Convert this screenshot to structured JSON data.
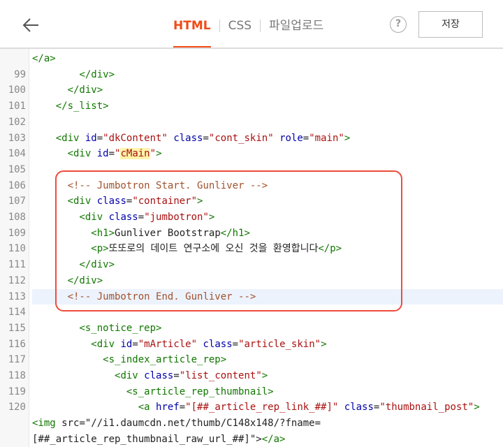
{
  "toolbar": {
    "tabs": [
      {
        "label": "HTML",
        "active": true
      },
      {
        "label": "CSS",
        "active": false
      },
      {
        "label": "파일업로드",
        "active": false
      }
    ],
    "help_label": "?",
    "save_label": "저장"
  },
  "editor": {
    "highlight_line": "113",
    "lines": [
      {
        "num": "",
        "text": "</a>"
      },
      {
        "num": "99",
        "text": "        </div>"
      },
      {
        "num": "100",
        "text": "      </div>"
      },
      {
        "num": "101",
        "text": "    </s_list>"
      },
      {
        "num": "102",
        "text": ""
      },
      {
        "num": "103",
        "text": "    <div id=\"dkContent\" class=\"cont_skin\" role=\"main\">"
      },
      {
        "num": "104",
        "text": "      <div id=\"cMain\">"
      },
      {
        "num": "105",
        "text": ""
      },
      {
        "num": "106",
        "text": "      <!-- Jumbotron Start. Gunliver -->"
      },
      {
        "num": "107",
        "text": "      <div class=\"container\">"
      },
      {
        "num": "108",
        "text": "        <div class=\"jumbotron\">"
      },
      {
        "num": "109",
        "text": "          <h1>Gunliver Bootstrap</h1>"
      },
      {
        "num": "110",
        "text": "          <p>또또로의 데이트 연구소에 오신 것을 환영합니다</p>"
      },
      {
        "num": "111",
        "text": "        </div>"
      },
      {
        "num": "112",
        "text": "      </div>"
      },
      {
        "num": "113",
        "text": "      <!-- Jumbotron End. Gunliver -->"
      },
      {
        "num": "114",
        "text": ""
      },
      {
        "num": "115",
        "text": "        <s_notice_rep>"
      },
      {
        "num": "116",
        "text": "          <div id=\"mArticle\" class=\"article_skin\">"
      },
      {
        "num": "117",
        "text": "            <s_index_article_rep>"
      },
      {
        "num": "118",
        "text": "              <div class=\"list_content\">"
      },
      {
        "num": "119",
        "text": "                <s_article_rep_thumbnail>"
      },
      {
        "num": "120",
        "text": "                  <a href=\"[##_article_rep_link_##]\" class=\"thumbnail_post\">"
      },
      {
        "num": "",
        "text": "<img src=\"//i1.daumcdn.net/thumb/C148x148/?fname="
      },
      {
        "num": "",
        "text": "[##_article_rep_thumbnail_raw_url_##]\"></a>"
      }
    ]
  }
}
